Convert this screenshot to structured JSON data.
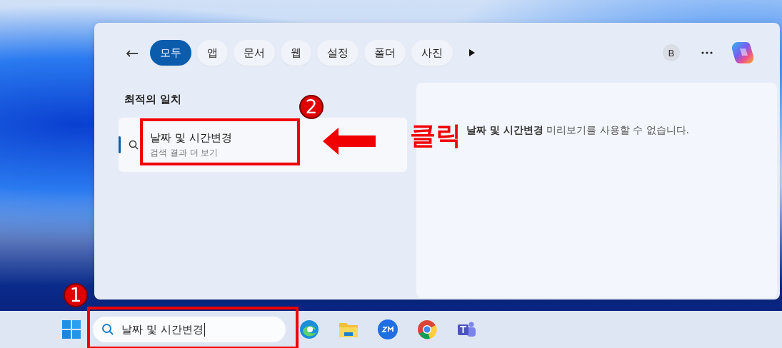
{
  "search_panel": {
    "back": "←",
    "filters": [
      {
        "label": "모두",
        "selected": true
      },
      {
        "label": "앱",
        "selected": false
      },
      {
        "label": "문서",
        "selected": false
      },
      {
        "label": "웹",
        "selected": false
      },
      {
        "label": "설정",
        "selected": false
      },
      {
        "label": "폴더",
        "selected": false
      },
      {
        "label": "사진",
        "selected": false
      }
    ],
    "profile_initial": "B",
    "best_match": {
      "heading": "최적의 일치",
      "title": "날짜 및 시간변경",
      "subtitle": "검색 결과 더 보기"
    },
    "preview": {
      "message": "**날짜 및 시간변경** 미리보기를 사용할 수 없습니다."
    }
  },
  "taskbar": {
    "search_value": "날짜 및 시간변경"
  },
  "annotations": [
    {
      "kind": "step",
      "number": "1"
    },
    {
      "kind": "step",
      "number": "2"
    },
    {
      "kind": "callout",
      "text": "클릭"
    }
  ]
}
